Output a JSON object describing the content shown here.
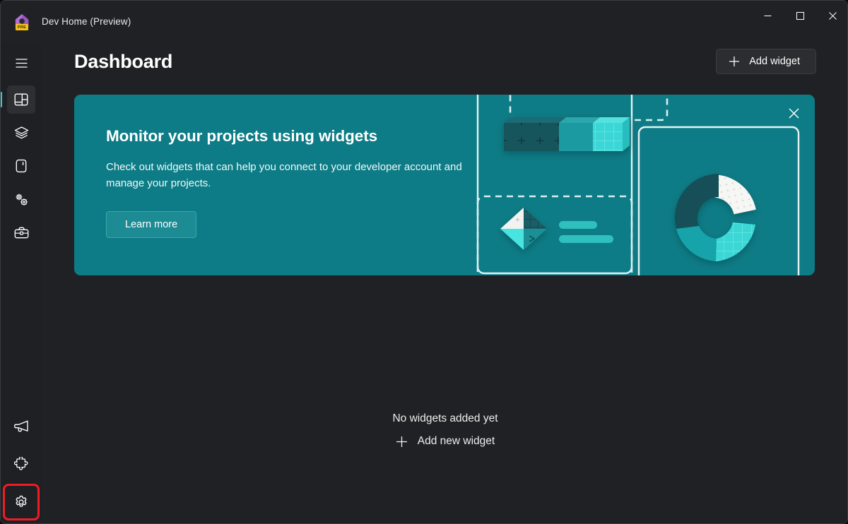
{
  "window": {
    "title": "Dev Home (Preview)",
    "app_icon": "dev-home-house-icon",
    "badge_text": "PRE",
    "controls": {
      "minimize": "minimize",
      "maximize": "maximize",
      "close": "close"
    }
  },
  "colors": {
    "app_background": "#202124",
    "sidebar_background": "#1e2023",
    "banner_teal": "#0e7c86",
    "accent_indicator": "#4cc2c4",
    "highlight_box": "#ee1c25",
    "text_primary": "#ffffff"
  },
  "sidebar": {
    "menu_button": {
      "label": "Navigation menu",
      "icon": "hamburger-menu-icon"
    },
    "items": [
      {
        "label": "Dashboard",
        "icon": "dashboard-icon",
        "selected": true
      },
      {
        "label": "Machine configuration",
        "icon": "layers-icon",
        "selected": false
      },
      {
        "label": "Environments",
        "icon": "device-icon",
        "selected": false
      },
      {
        "label": "Utilities",
        "icon": "gears-icon",
        "selected": false
      },
      {
        "label": "Toolbox",
        "icon": "toolbox-icon",
        "selected": false
      }
    ],
    "bottom_items": [
      {
        "label": "Send feedback",
        "icon": "megaphone-icon",
        "highlighted": false
      },
      {
        "label": "Extensions",
        "icon": "puzzle-piece-icon",
        "highlighted": false
      },
      {
        "label": "Settings",
        "icon": "gear-icon",
        "highlighted": true
      }
    ]
  },
  "header": {
    "title": "Dashboard",
    "add_widget_label": "Add widget",
    "add_widget_icon": "plus-icon"
  },
  "banner": {
    "title": "Monitor your projects using widgets",
    "body": "Check out widgets that can help you connect to your developer account and manage your projects.",
    "cta_label": "Learn more",
    "close_icon": "close-icon",
    "art": {
      "bar_chart_card": "solid-border-card",
      "diamond_card": "dashed-border-card",
      "donut_card": "solid-border-card",
      "top_placeholder_card": "dashed-border-card"
    }
  },
  "empty_state": {
    "title": "No widgets added yet",
    "add_label": "Add new widget",
    "add_icon": "plus-icon"
  }
}
